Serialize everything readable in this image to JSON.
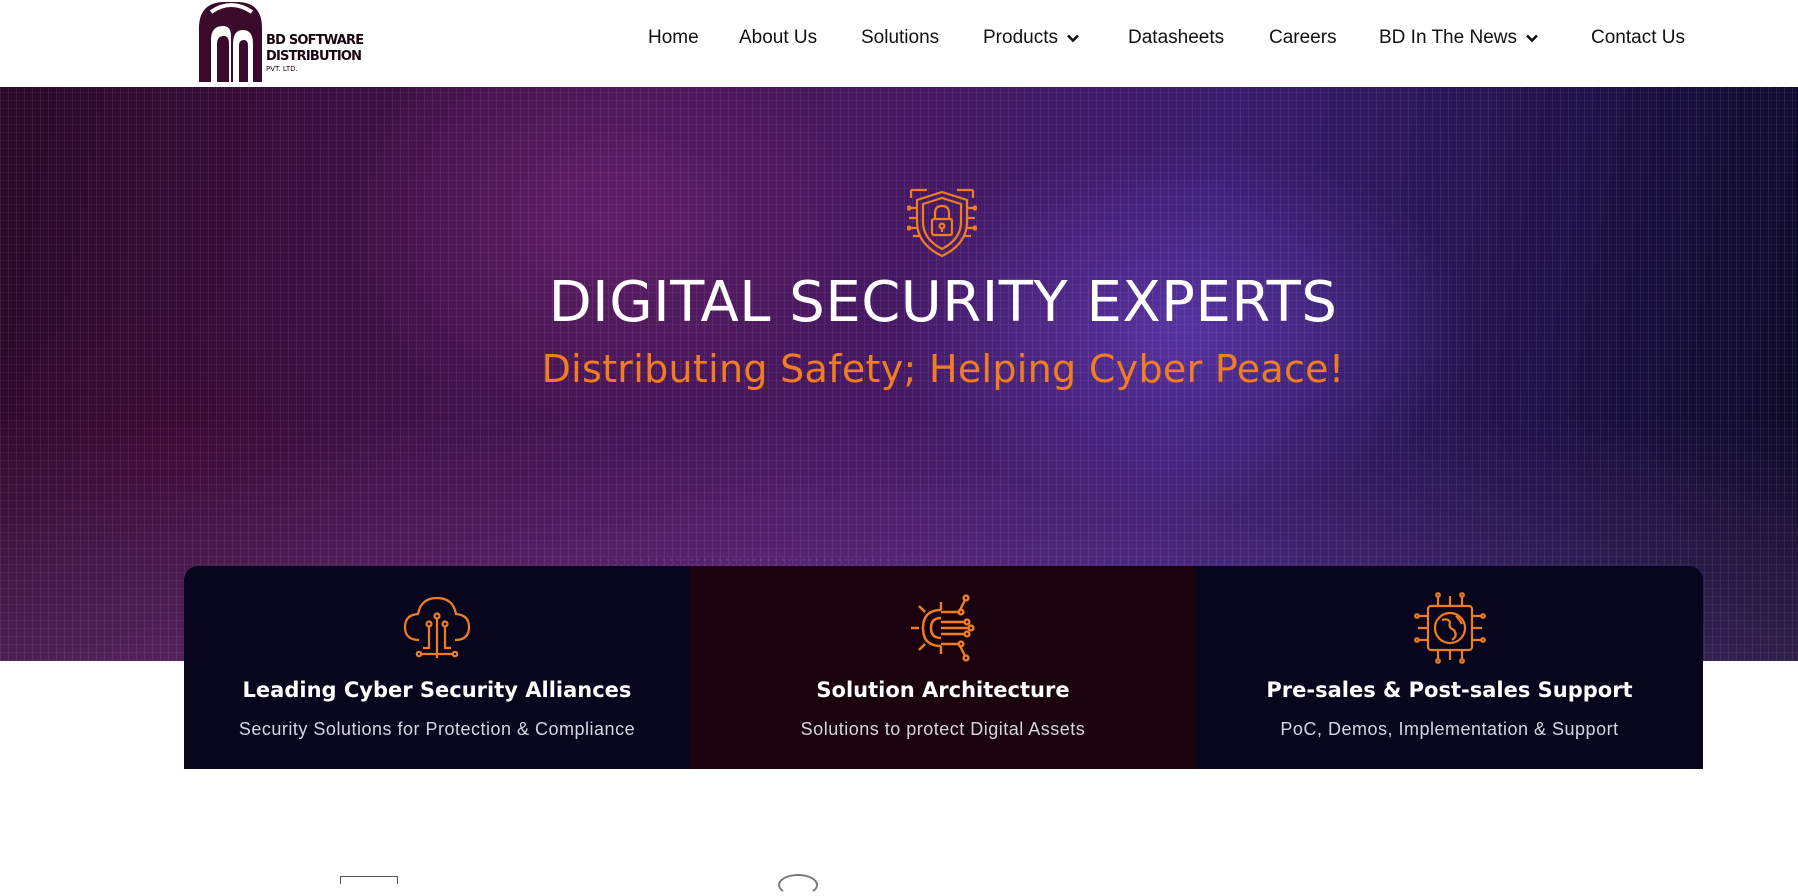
{
  "brand": {
    "name_line1": "BD SOFTWARE",
    "name_line2": "DISTRIBUTION",
    "name_line3": "PVT. LTD.",
    "color_primary": "#3b0a2a"
  },
  "nav": {
    "items": [
      {
        "label": "Home"
      },
      {
        "label": "About Us"
      },
      {
        "label": "Solutions"
      },
      {
        "label": "Products",
        "has_dropdown": true
      },
      {
        "label": "Datasheets"
      },
      {
        "label": "Careers"
      },
      {
        "label": "BD In The News",
        "has_dropdown": true
      },
      {
        "label": "Contact Us"
      }
    ]
  },
  "hero": {
    "icon": "shield-lock-circuit-icon",
    "title": "DIGITAL SECURITY EXPERTS",
    "subtitle": "Distributing Safety; Helping Cyber Peace!",
    "accent_color": "#f07d22"
  },
  "features": [
    {
      "icon": "cloud-circuit-icon",
      "title": "Leading Cyber Security Alliances",
      "description": "Security Solutions for Protection & Compliance"
    },
    {
      "icon": "gear-circuit-icon",
      "title": "Solution Architecture",
      "description": "Solutions to protect Digital Assets"
    },
    {
      "icon": "globe-circuit-icon",
      "title": "Pre-sales & Post-sales Support",
      "description": "PoC, Demos, Implementation & Support"
    }
  ]
}
